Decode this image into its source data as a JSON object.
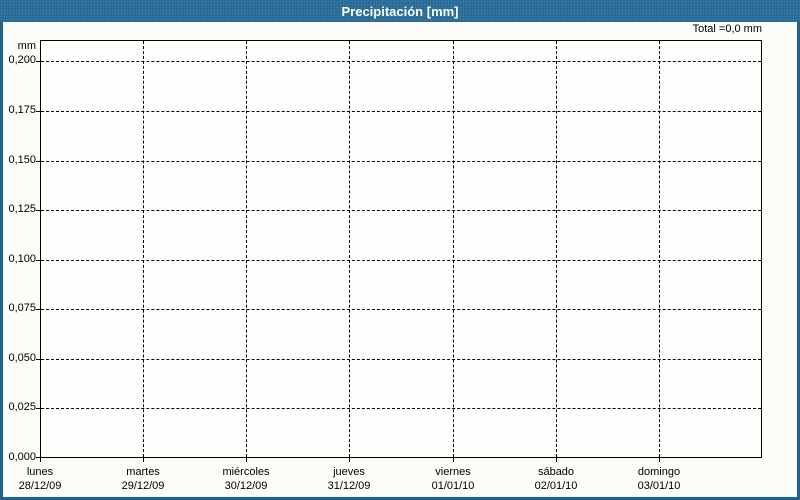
{
  "window": {
    "title": "Precipitación [mm]",
    "total_label": "Total =0,0 mm",
    "colors": {
      "titlebar_blue": "#226795",
      "frame_blue": "#1d6291",
      "background": "#fcfdf9",
      "grid": "#000000",
      "text": "#000000",
      "title_text": "#ffffff"
    }
  },
  "chart_data": {
    "type": "bar",
    "title": "Precipitación [mm]",
    "ylabel": "mm",
    "total_annotation": "Total =0,0 mm",
    "total_mm": 0.0,
    "categories": [
      "lunes",
      "martes",
      "miércoles",
      "jueves",
      "viernes",
      "sábado",
      "domingo"
    ],
    "category_dates": [
      "28/12/09",
      "29/12/09",
      "30/12/09",
      "31/12/09",
      "01/01/10",
      "02/01/10",
      "03/01/10"
    ],
    "values": [
      0,
      0,
      0,
      0,
      0,
      0,
      0
    ],
    "y_ticks": [
      {
        "value": 0.2,
        "label": "0,200"
      },
      {
        "value": 0.175,
        "label": "0,175"
      },
      {
        "value": 0.15,
        "label": "0,150"
      },
      {
        "value": 0.125,
        "label": "0,125"
      },
      {
        "value": 0.1,
        "label": "0,100"
      },
      {
        "value": 0.075,
        "label": "0,075"
      },
      {
        "value": 0.05,
        "label": "0,050"
      },
      {
        "value": 0.025,
        "label": "0,025"
      },
      {
        "value": 0.0,
        "label": "0,000"
      }
    ],
    "ylim": [
      0,
      0.2108
    ],
    "grid": true,
    "legend": null
  }
}
